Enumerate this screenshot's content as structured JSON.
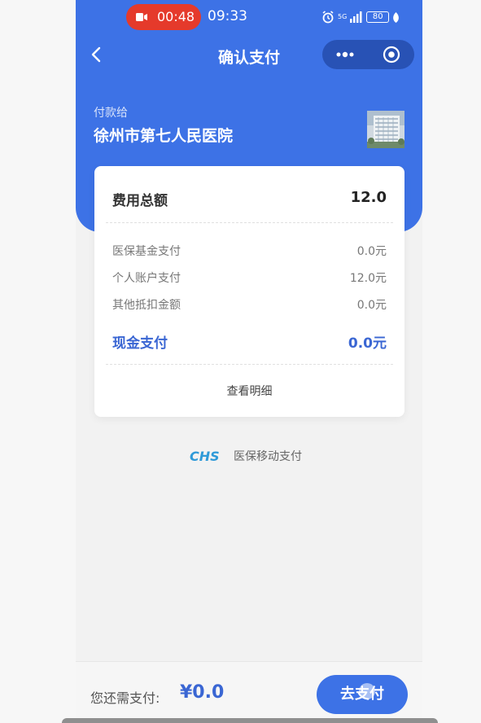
{
  "status_bar": {
    "recording_time": "00:48",
    "clock": "09:33",
    "network": "5G",
    "battery": "80",
    "icons": [
      "camera-record-icon",
      "alarm-icon",
      "signal-icon",
      "battery-icon",
      "leaf-icon"
    ]
  },
  "nav": {
    "title": "确认支付",
    "back_icon": "chevron-left-icon",
    "more_icon": "more-dots-icon",
    "target_icon": "target-circle-icon"
  },
  "payee": {
    "label": "付款给",
    "name": "徐州市第七人民医院"
  },
  "bill": {
    "total_label": "费用总额",
    "total_value": "12.0",
    "items": [
      {
        "label": "医保基金支付",
        "value": "0.0元"
      },
      {
        "label": "个人账户支付",
        "value": "12.0元"
      },
      {
        "label": "其他抵扣金额",
        "value": "0.0元"
      }
    ],
    "cash_label": "现金支付",
    "cash_value": "0.0元",
    "details_link": "查看明细"
  },
  "brand": {
    "logo_text": "CHS",
    "name": "医保移动支付"
  },
  "footer": {
    "remain_label": "您还需支付:",
    "remain_amount": "¥0.0",
    "pay_button": "去支付"
  },
  "colors": {
    "primary": "#3d72e6",
    "accent_text": "#3a66d3",
    "recording": "#e53a2b",
    "background": "#f2f2f2"
  }
}
